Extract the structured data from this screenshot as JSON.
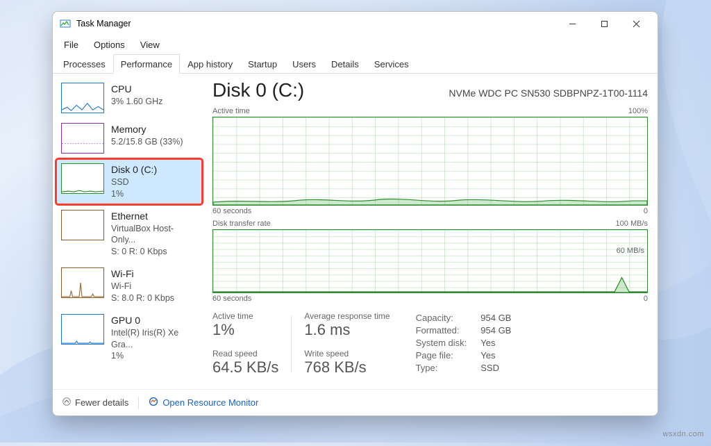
{
  "window": {
    "title": "Task Manager"
  },
  "menus": [
    "File",
    "Options",
    "View"
  ],
  "tabs": {
    "items": [
      "Processes",
      "Performance",
      "App history",
      "Startup",
      "Users",
      "Details",
      "Services"
    ],
    "active": 1
  },
  "sidebar": {
    "items": [
      {
        "title": "CPU",
        "line1": "3% 1.60 GHz",
        "line2": "",
        "border": "#1f77d0"
      },
      {
        "title": "Memory",
        "line1": "5.2/15.8 GB (33%)",
        "line2": "",
        "border": "#8a2ea6"
      },
      {
        "title": "Disk 0 (C:)",
        "line1": "SSD",
        "line2": "1%",
        "border": "#2e8b2e",
        "selected": true
      },
      {
        "title": "Ethernet",
        "line1": "VirtualBox Host-Only...",
        "line2": "S: 0 R: 0 Kbps",
        "border": "#8c5a2b"
      },
      {
        "title": "Wi-Fi",
        "line1": "Wi-Fi",
        "line2": "S: 8.0 R: 0 Kbps",
        "border": "#8c5a2b"
      },
      {
        "title": "GPU 0",
        "line1": "Intel(R) Iris(R) Xe Gra...",
        "line2": "1%",
        "border": "#1f77d0"
      }
    ]
  },
  "main": {
    "title": "Disk 0 (C:)",
    "model": "NVMe WDC PC SN530 SDBPNPZ-1T00-1114",
    "chart1": {
      "topLeft": "Active time",
      "topRight": "100%",
      "bottomLeft": "60 seconds",
      "bottomRight": "0"
    },
    "chart2": {
      "topLeft": "Disk transfer rate",
      "topRight": "100 MB/s",
      "midRight": "60 MB/s",
      "bottomLeft": "60 seconds",
      "bottomRight": "0"
    },
    "stats": {
      "activeTime": {
        "label": "Active time",
        "value": "1%"
      },
      "avgResp": {
        "label": "Average response time",
        "value": "1.6 ms"
      },
      "readSpeed": {
        "label": "Read speed",
        "value": "64.5 KB/s"
      },
      "writeSpeed": {
        "label": "Write speed",
        "value": "768 KB/s"
      }
    },
    "kv": [
      {
        "k": "Capacity:",
        "v": "954 GB"
      },
      {
        "k": "Formatted:",
        "v": "954 GB"
      },
      {
        "k": "System disk:",
        "v": "Yes"
      },
      {
        "k": "Page file:",
        "v": "Yes"
      },
      {
        "k": "Type:",
        "v": "SSD"
      }
    ]
  },
  "footer": {
    "fewer": "Fewer details",
    "monitor": "Open Resource Monitor"
  },
  "watermark": "wsxdn.com",
  "chart_data": [
    {
      "type": "area",
      "title": "Active time",
      "xlabel": "seconds ago",
      "ylabel": "%",
      "ylim": [
        0,
        100
      ],
      "x": [
        60,
        55,
        50,
        45,
        40,
        35,
        30,
        25,
        20,
        15,
        10,
        5,
        0
      ],
      "values": [
        3,
        4,
        5,
        6,
        6,
        5,
        7,
        5,
        4,
        4,
        4,
        5,
        4
      ]
    },
    {
      "type": "area",
      "title": "Disk transfer rate",
      "xlabel": "seconds ago",
      "ylabel": "MB/s",
      "ylim": [
        0,
        100
      ],
      "series": [
        {
          "name": "read",
          "x": [
            60,
            8,
            6,
            4,
            2,
            0
          ],
          "values": [
            0,
            0,
            22,
            0,
            0,
            0
          ]
        },
        {
          "name": "write",
          "x": [
            60,
            0
          ],
          "values": [
            0,
            0
          ]
        }
      ]
    }
  ]
}
